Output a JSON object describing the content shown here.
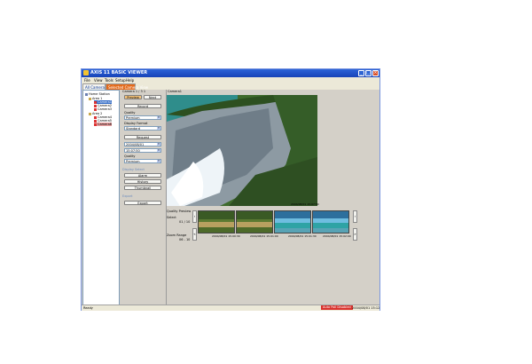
{
  "window": {
    "title": "AXIS 11 BASIC VIEWER",
    "controls": [
      "_",
      "□",
      "×"
    ]
  },
  "menu": [
    "File",
    "View",
    "Tools",
    "Setup",
    "Help"
  ],
  "tabs": [
    {
      "label": "All Camera View"
    },
    {
      "label": "Selected Camera View"
    }
  ],
  "tree": {
    "root": "Home Station",
    "groups": [
      {
        "label": "Area 1",
        "cameras": [
          "Camera1",
          "Camera2",
          "Camera3"
        ]
      },
      {
        "label": "Area 2",
        "cameras": [
          "Camera4",
          "Camera5",
          "Camera6"
        ]
      }
    ],
    "selected": "Camera1"
  },
  "controls": {
    "header": "Camera 1 / 3 1",
    "preview_button": "Preview",
    "next_button": "Next",
    "record_button": "Record",
    "quality_label": "Quality",
    "quality_value": "Premium",
    "display_format_label": "Display Format",
    "display_format_value": "Standard",
    "request_button": "Request",
    "date_value": "2004/08/01",
    "time_value": "15:07:50",
    "quality2_label": "Quality",
    "quality2_value": "Premium",
    "display_select_label": "Display Select",
    "alarm_button": "Alarm",
    "history_button": "History",
    "thumbnail_button": "Thumbnail",
    "export_label": "Export",
    "export_button": "Export"
  },
  "viewer": {
    "title": "Camera1",
    "image_timestamp": "2004/08/01 15:07:50",
    "quality_preview_label": "Quality Preview",
    "select_label": "Select",
    "select_value": "01 / 10",
    "zoom_range_label": "Zoom Range",
    "zoom_range_value": "06 - 10",
    "thumbnails": [
      {
        "timestamp": "2004/08/01 15:00:30"
      },
      {
        "timestamp": "2004/08/01 15:01:00"
      },
      {
        "timestamp": "2004/08/01 15:01:30"
      },
      {
        "timestamp": "2004/08/01 15:02:00"
      }
    ]
  },
  "status": {
    "left": "Ready",
    "badge": "Auto Poll Disabled",
    "right": "2004/08/01 15:12"
  }
}
